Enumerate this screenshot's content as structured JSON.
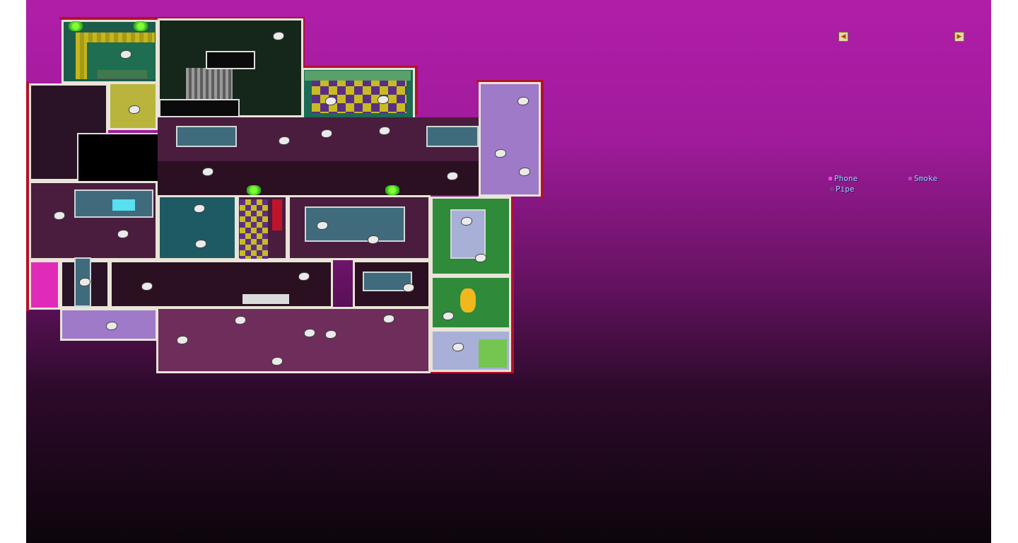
{
  "navigation": {
    "prev_icon": "arrow-left-icon",
    "next_icon": "arrow-right-icon"
  },
  "legend": [
    {
      "label": "Phone",
      "color": "#e848d8"
    },
    {
      "label": "Smoke",
      "color": "#b844c0"
    },
    {
      "label": "Pipe",
      "color": "#7a3a8a"
    }
  ],
  "colors": {
    "bg_top": "#b01ea8",
    "bg_bottom": "#0d050c",
    "wall": "#b3112b",
    "trim": "#e9e4d8"
  }
}
